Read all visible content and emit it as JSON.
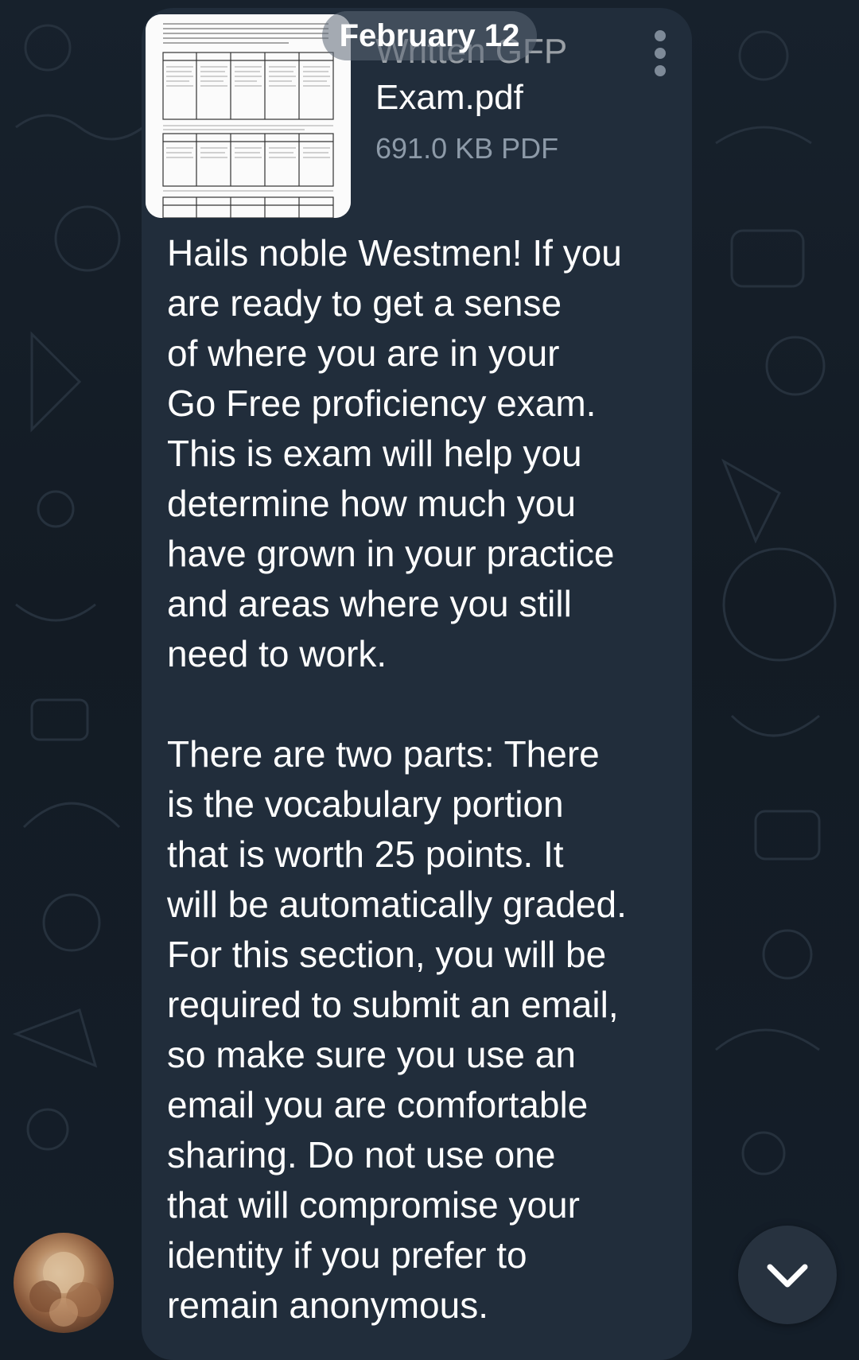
{
  "date_header": "February 12",
  "attachment": {
    "file_name_line1": "Written GFP",
    "file_name_line2": "Exam.pdf",
    "file_meta": "691.0 KB PDF",
    "thumbnail_icon": "pdf-page-preview"
  },
  "message": {
    "text": "Hails noble Westmen! If you\nare ready to get a sense\nof where you are in your\nGo Free proficiency exam.\nThis is exam will help you\ndetermine how much you\nhave grown in your practice\nand areas where you still\nneed to work.\n\nThere are two parts: There\nis the vocabulary portion\nthat is worth 25 points. It\nwill be automatically graded.\nFor this section, you will be\nrequired to submit an email,\nso make sure you use an\nemail you are comfortable\nsharing. Do not use one\nthat will compromise your\nidentity if you prefer to\nremain anonymous."
  },
  "icons": {
    "menu": "vertical-dots-icon",
    "scroll": "chevron-down-icon",
    "avatar": "user-avatar"
  },
  "colors": {
    "background": "#141d27",
    "bubble": "#212d3b",
    "text": "#ffffff",
    "meta": "#8d9aa8"
  }
}
